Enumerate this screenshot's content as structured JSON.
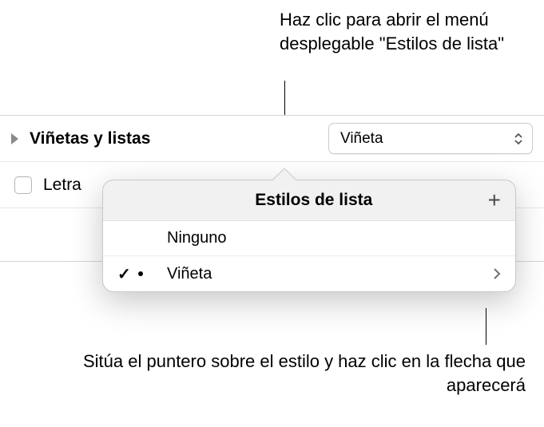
{
  "callouts": {
    "top": "Haz clic para abrir el menú desplegable \"Estilos de lista\"",
    "bottom": "Sitúa el puntero sobre el estilo y haz clic en la flecha que aparecerá"
  },
  "inspector": {
    "section_label": "Viñetas y listas",
    "popup_value": "Viñeta",
    "secondary_label": "Letra"
  },
  "popover": {
    "title": "Estilos de lista",
    "items": [
      {
        "label": "Ninguno",
        "selected": false,
        "has_sample": false
      },
      {
        "label": "Viñeta",
        "selected": true,
        "has_sample": true
      }
    ]
  }
}
